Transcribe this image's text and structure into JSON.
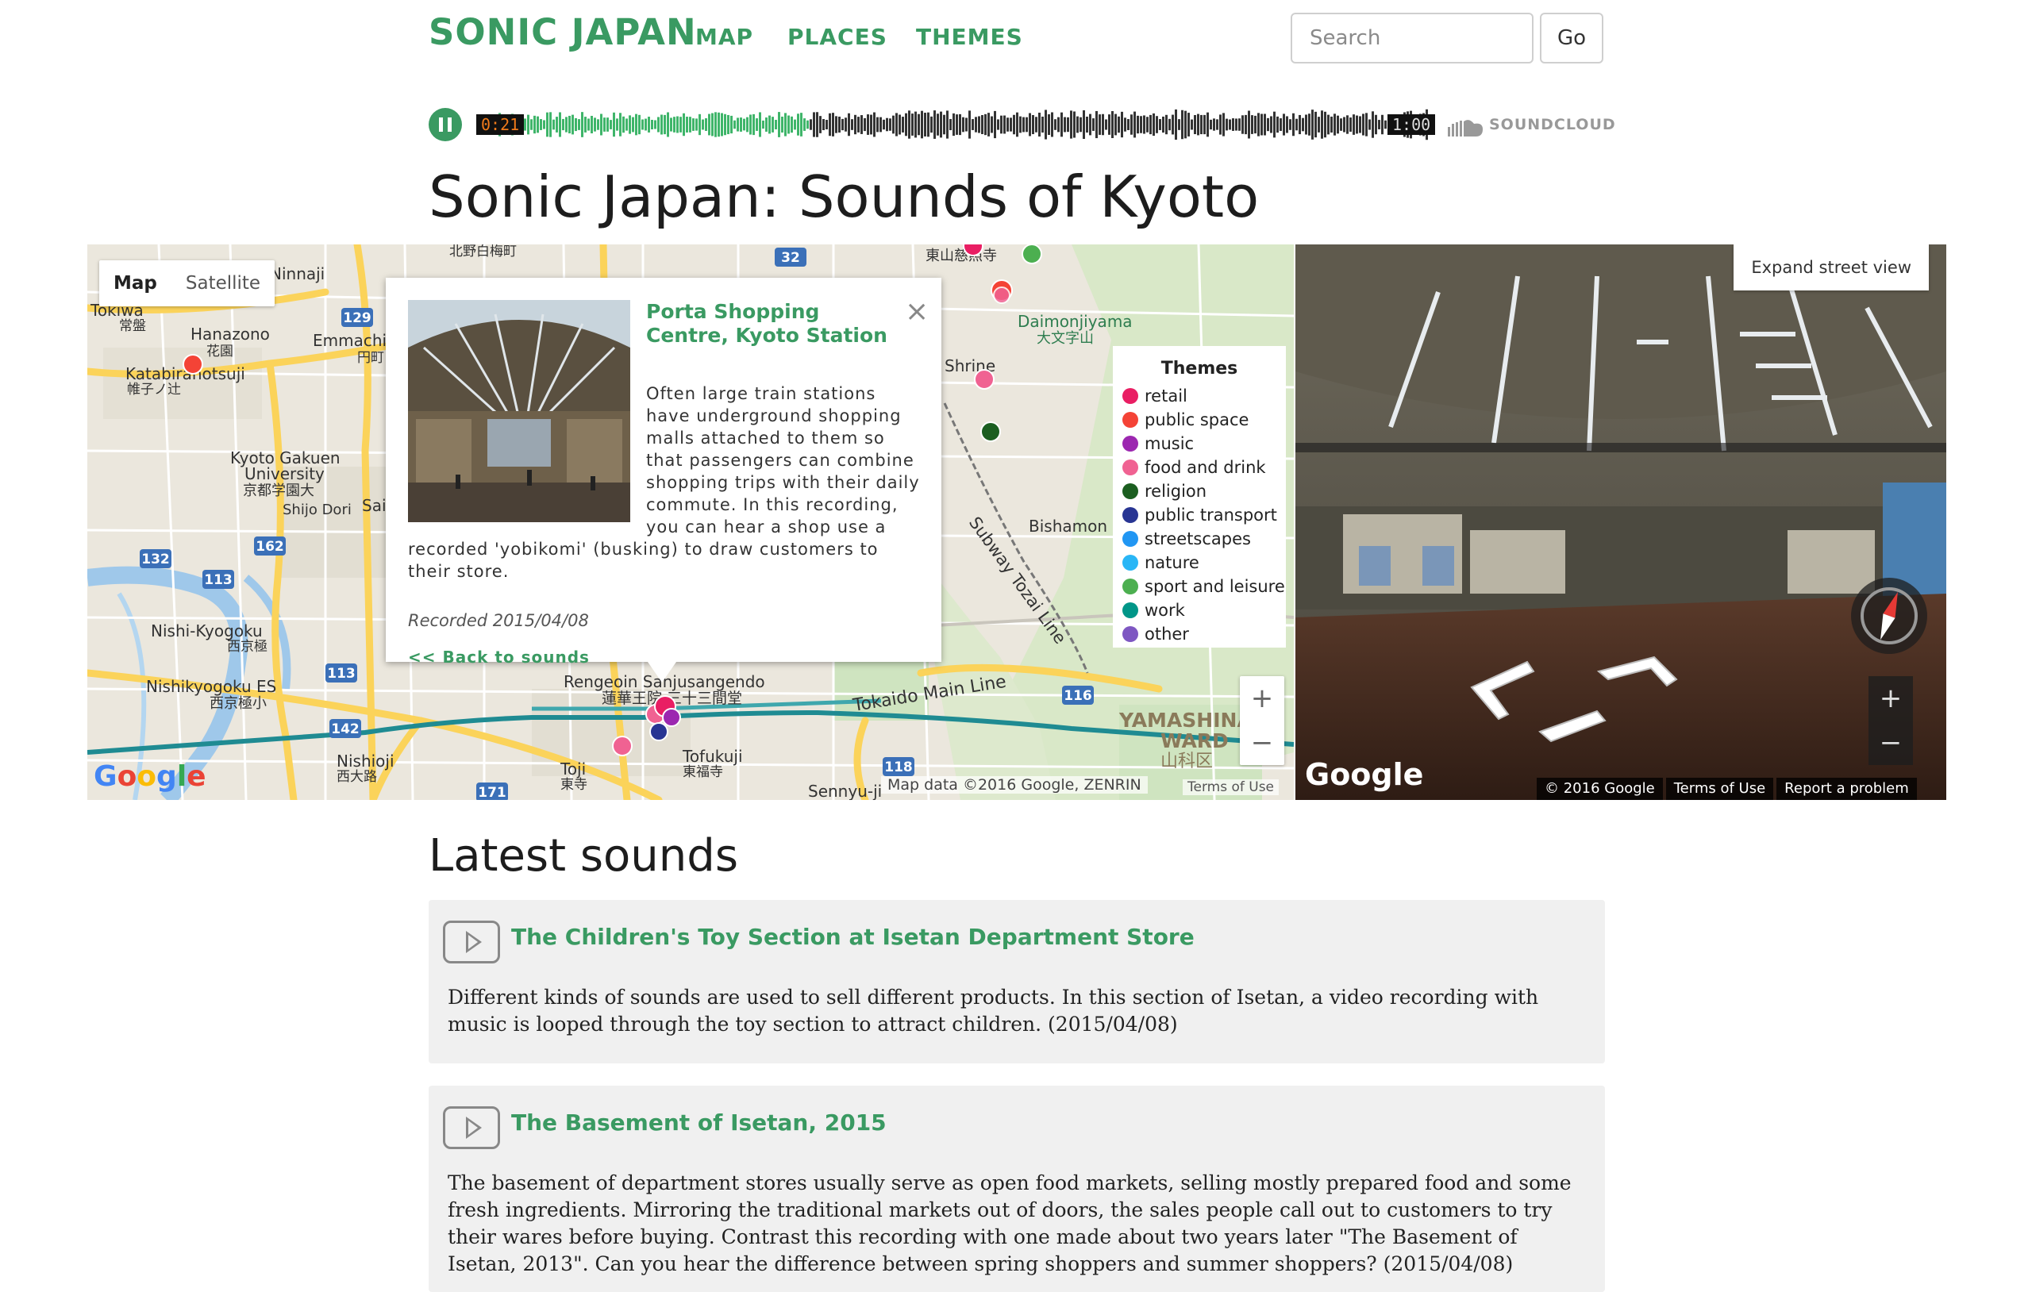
{
  "header": {
    "logo": "SONIC JAPAN",
    "nav": [
      "MAP",
      "PLACES",
      "THEMES"
    ],
    "search_placeholder": "Search",
    "go_label": "Go"
  },
  "player": {
    "current_time": "0:21",
    "total_time": "1:00",
    "progress": 0.35,
    "provider": "SOUNDCLOUD",
    "state": "playing"
  },
  "page_title": "Sonic Japan: Sounds of Kyoto",
  "map": {
    "type_buttons": [
      "Map",
      "Satellite"
    ],
    "active_type": "Map",
    "labels": [
      "Hanazono",
      "花園",
      "Katabiranotsuji",
      "帷子ノ辻",
      "Kyoto Gakuen",
      "University",
      "京都学園大",
      "Shijo Dori",
      "Emmachi",
      "円町",
      "Nishi-Kyogoku",
      "西京極",
      "Nishikyogoku ES",
      "西京極小",
      "Nishioji",
      "西大路",
      "Toji",
      "東寺",
      "Tofukuji",
      "東福寺",
      "Sennyu-ji",
      "Rengeoin Sanjusangendo",
      "蓮華王院 三十三間堂",
      "Daimonjiyama",
      "大文字山",
      "Bishamon",
      "Subway Tozai Line",
      "Tokaido Main Line",
      "YAMASHINA",
      "WARD",
      "山科区",
      "Shrine",
      "東山慈照寺",
      "北野白梅町",
      "Tokiwa",
      "常盤",
      "Ninnaji",
      "Saiin"
    ],
    "route_numbers": [
      "129",
      "132",
      "113",
      "162",
      "142",
      "171",
      "118",
      "116",
      "32"
    ],
    "credit": "Map data ©2016 Google, ZENRIN",
    "terms": "Terms of Use",
    "logo": "Google",
    "zoom_in": "+",
    "zoom_out": "−"
  },
  "popup": {
    "title": "Porta Shopping Centre, Kyoto Station",
    "description": "Often large train stations have underground shopping malls attached to them so that passengers can combine shopping trips with their daily commute. In this recording, you can hear a shop use a recorded 'yobikomi' (busking) to draw customers to their store.",
    "recorded": "Recorded 2015/04/08",
    "back_link": "<< Back to sounds",
    "close": "×"
  },
  "legend": {
    "title": "Themes",
    "items": [
      {
        "label": "retail",
        "color": "#e91e63"
      },
      {
        "label": "public space",
        "color": "#f44336"
      },
      {
        "label": "music",
        "color": "#9c27b0"
      },
      {
        "label": "food and drink",
        "color": "#f06292"
      },
      {
        "label": "religion",
        "color": "#1b5e20"
      },
      {
        "label": "public transport",
        "color": "#283593"
      },
      {
        "label": "streetscapes",
        "color": "#2196f3"
      },
      {
        "label": "nature",
        "color": "#29b6f6"
      },
      {
        "label": "sport and leisure",
        "color": "#4caf50"
      },
      {
        "label": "work",
        "color": "#009688"
      },
      {
        "label": "other",
        "color": "#7e57c2"
      }
    ]
  },
  "street_view": {
    "expand_label": "Expand street view",
    "logo": "Google",
    "copyright": "© 2016 Google",
    "terms": "Terms of Use",
    "report": "Report a problem",
    "zoom_in": "+",
    "zoom_out": "−"
  },
  "latest": {
    "title": "Latest sounds",
    "items": [
      {
        "title": "The Children's Toy Section at Isetan Department Store",
        "description": "Different kinds of sounds are used to sell different products. In this section of Isetan, a video recording with music is looped through the toy section to attract children. (2015/04/08)"
      },
      {
        "title": "The Basement of Isetan, 2015",
        "description": "The basement of department stores usually serve as open food markets, selling mostly prepared food and some fresh ingredients. Mirroring the traditional markets out of doors, the sales people call out to customers to try their wares before buying. Contrast this recording with one made about two years later \"The Basement of Isetan, 2013\". Can you hear the difference between spring shoppers and summer shoppers? (2015/04/08)"
      }
    ]
  },
  "colors": {
    "brand_green": "#3a9a62",
    "waveform_played": "#3fb56a",
    "waveform_unplayed": "#333333"
  }
}
